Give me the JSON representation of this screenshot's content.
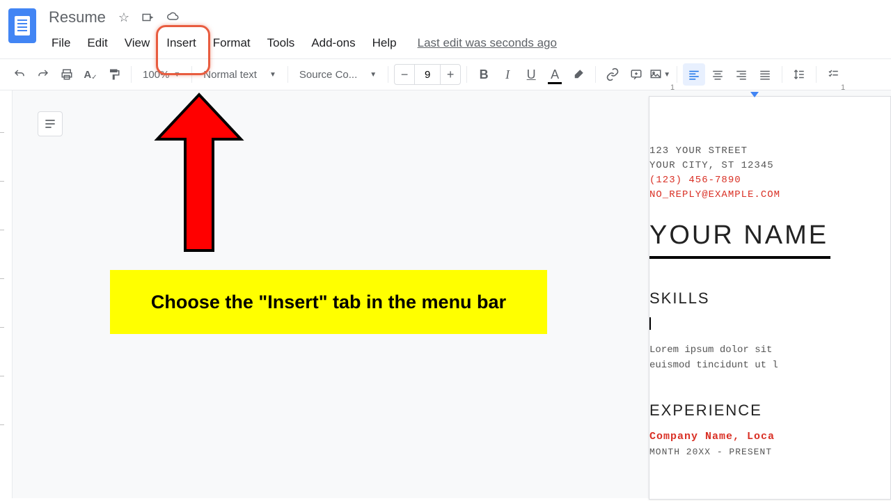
{
  "header": {
    "doc_title": "Resume",
    "menu": {
      "file": "File",
      "edit": "Edit",
      "view": "View",
      "insert": "Insert",
      "format": "Format",
      "tools": "Tools",
      "addons": "Add-ons",
      "help": "Help"
    },
    "last_edit": "Last edit was seconds ago"
  },
  "toolbar": {
    "zoom": "100%",
    "style": "Normal text",
    "font": "Source Co...",
    "font_size": "9"
  },
  "ruler": {
    "n1": "1",
    "n2": "1"
  },
  "resume": {
    "street": "123 YOUR STREET",
    "city": "YOUR CITY, ST 12345",
    "phone": "(123) 456-7890",
    "email": "NO_REPLY@EXAMPLE.COM",
    "name": "YOUR NAME",
    "skills_h": "SKILLS",
    "lorem1": "Lorem ipsum dolor sit ",
    "lorem2": "euismod tincidunt ut l",
    "exp_h": "EXPERIENCE",
    "company": "Company Name, Loca",
    "dates": "MONTH 20XX - PRESENT"
  },
  "annotation": {
    "callout": "Choose the \"Insert\" tab in the menu bar"
  }
}
